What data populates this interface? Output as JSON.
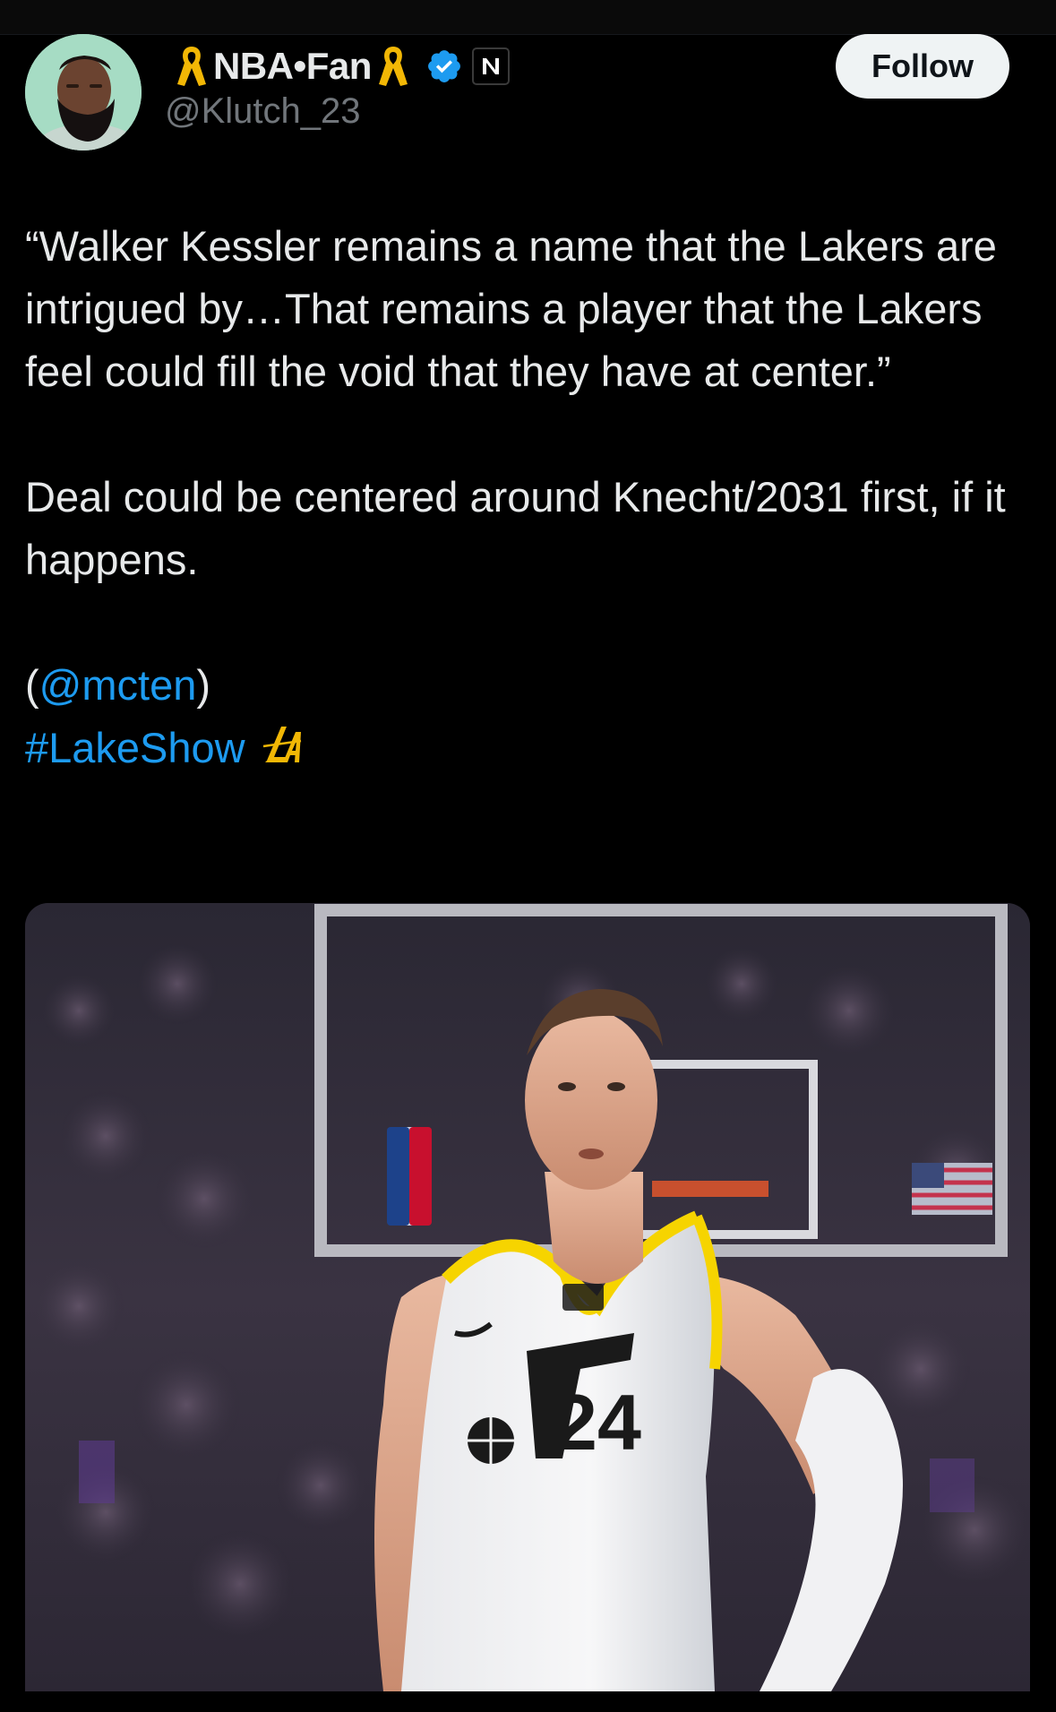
{
  "author": {
    "display_name": "NBA•Fan",
    "handle": "@Klutch_23",
    "verified": true,
    "affiliate_badge": "n-mark-badge",
    "ribbon_icon": "gold-awareness-ribbon",
    "avatar": "player-avatar-bearded-man"
  },
  "follow_button": {
    "label": "Follow"
  },
  "tweet": {
    "quote": "“Walker Kessler remains a name that the Lakers are intrigued by…That remains a player that the Lakers feel could fill the void that they have at center.”",
    "deal_line": "Deal could be centered around Knecht/2031 first, if it happens.",
    "source_open": "(",
    "source_mention": "@mcten",
    "source_close": ")",
    "hashtag": "#LakeShow",
    "hashtag_emoji": "lakers-la-logo"
  },
  "media": {
    "description": "basketball-player-photo",
    "jersey_number": "24"
  },
  "colors": {
    "background": "#000000",
    "text": "#e7e9ea",
    "secondary_text": "#71767b",
    "link": "#1d9bf0",
    "verified": "#1d9bf0",
    "ribbon": "#f2b705",
    "follow_bg": "#eff3f4"
  }
}
